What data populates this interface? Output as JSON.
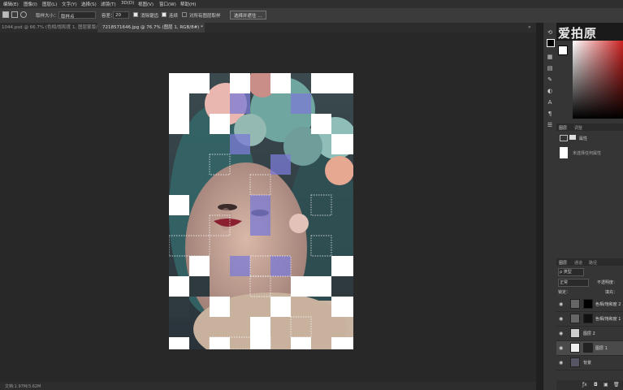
{
  "menu": [
    "编辑(E)",
    "图像(I)",
    "图层(L)",
    "文字(Y)",
    "选择(S)",
    "滤镜(T)",
    "3D(D)",
    "视图(V)",
    "窗口(W)",
    "帮助(H)"
  ],
  "options": {
    "style_label": "取样大小：",
    "style_value": "取样点",
    "tolerance_label": "容差：",
    "tolerance_value": "20",
    "antialias_label": "消除锯齿",
    "contiguous_label": "连续",
    "all_layers_label": "对所有图层取样",
    "select_subject_label": "选择并遮住 ..."
  },
  "tabs": {
    "tab1": "1044.psd @ 66.7% (色相/饱和度 1, 图层蒙版/8) *",
    "tab2": "7218571646.jpg @ 76.7% (图层 1, RGB/8#) *"
  },
  "watermark": "爱拍原",
  "status": "文档:1.97M/3.62M",
  "panel": {
    "adjust_tabs": [
      "图层",
      "调整"
    ],
    "properties_label": "属性",
    "properties_sub": "未选择任何属性",
    "layers_tabs": [
      "图层",
      "通道",
      "路径"
    ],
    "kind_label": "ρ 类型",
    "blend_mode": "正常",
    "opacity_label": "不透明度：",
    "lock_label": "锁定：",
    "fill_label": "填充：",
    "layers": [
      {
        "name": "色相/饱和度 2"
      },
      {
        "name": "色相/饱和度 1"
      },
      {
        "name": "图层 2"
      },
      {
        "name": "图层 1"
      },
      {
        "name": "背景"
      }
    ]
  },
  "colors": {
    "accent": "#7b7bd6",
    "swatch": "#cc2222"
  }
}
